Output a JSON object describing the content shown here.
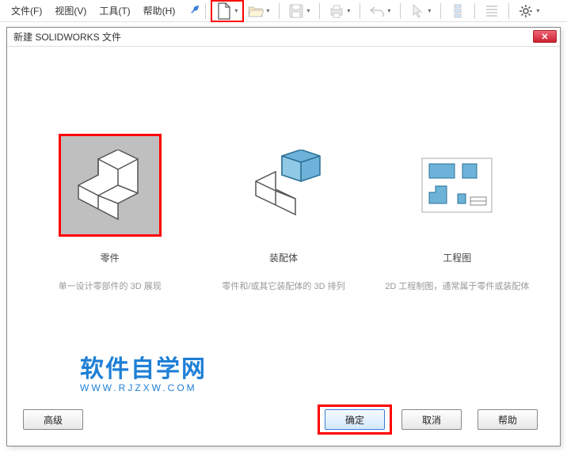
{
  "menubar": {
    "file": "文件(F)",
    "view": "视图(V)",
    "tools": "工具(T)",
    "help": "帮助(H)"
  },
  "dialog": {
    "title": "新建 SOLIDWORKS 文件",
    "options": {
      "part": {
        "title": "零件",
        "desc": "单一设计零部件的 3D 展现"
      },
      "assembly": {
        "title": "装配体",
        "desc": "零件和/或其它装配体的 3D 排列"
      },
      "drawing": {
        "title": "工程图",
        "desc": "2D 工程制图，通常属于零件或装配体"
      }
    },
    "buttons": {
      "advanced": "高级",
      "ok": "确定",
      "cancel": "取消",
      "help": "帮助"
    }
  },
  "watermark": {
    "main": "软件自学网",
    "sub": "WWW.RJZXW.COM"
  }
}
